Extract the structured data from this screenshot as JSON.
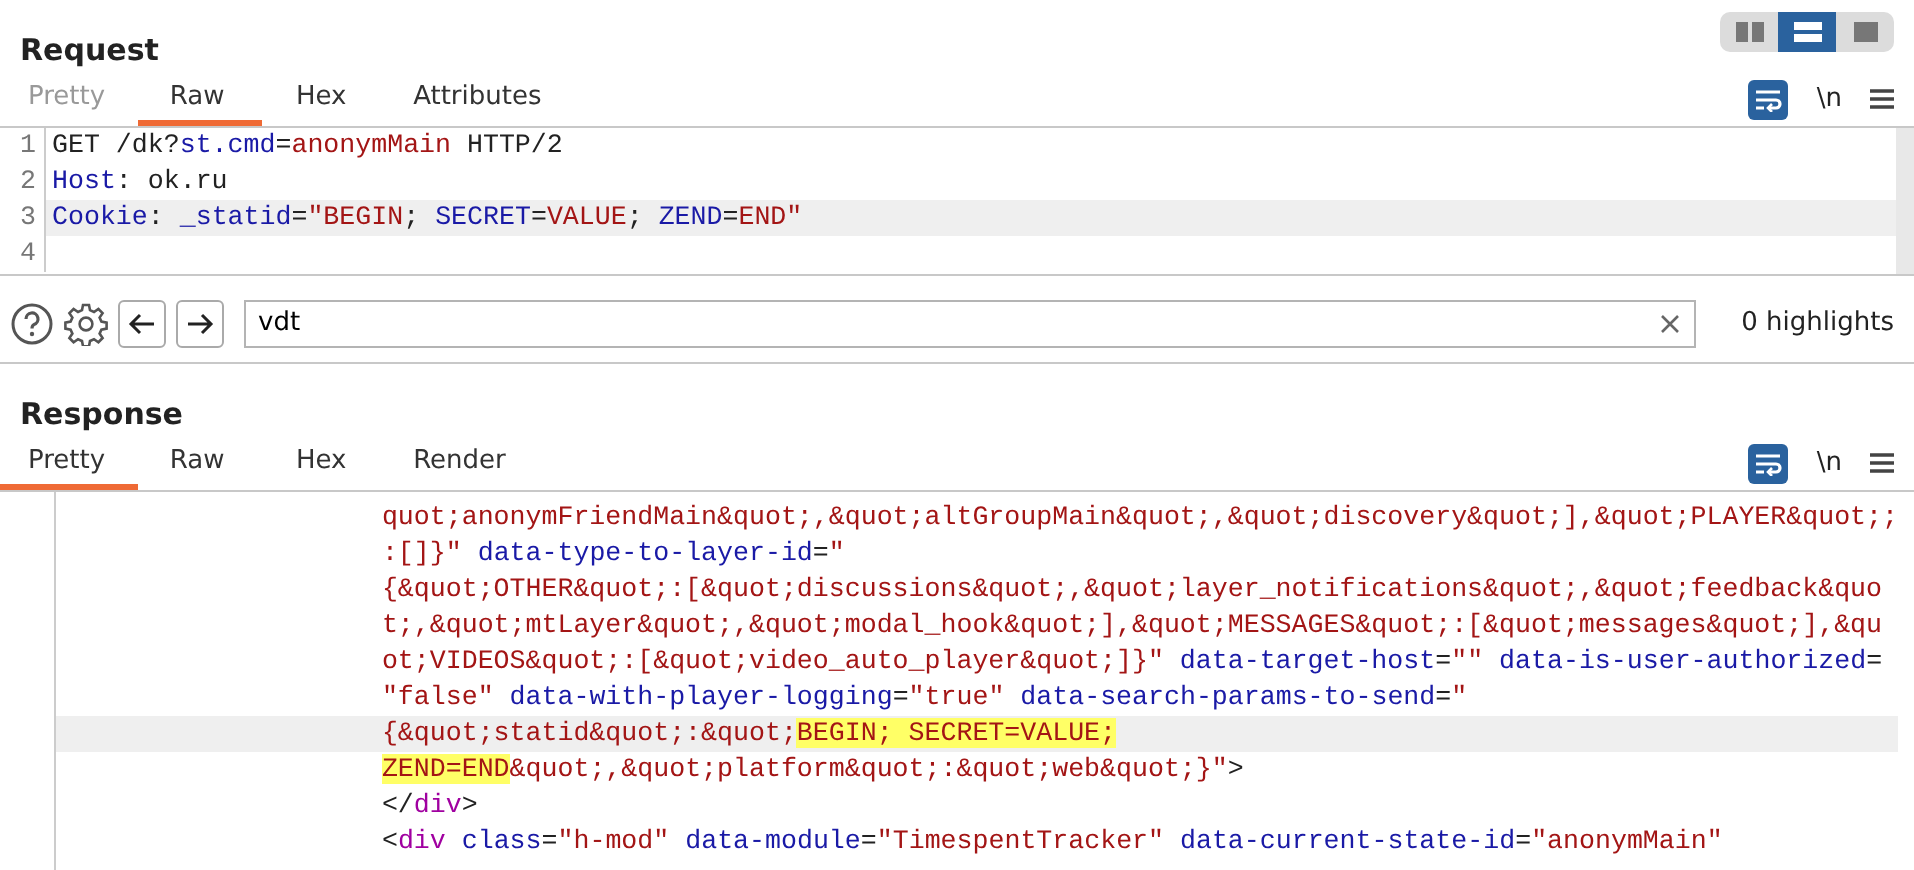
{
  "layout_switcher": [
    {
      "selected": false
    },
    {
      "selected": true
    },
    {
      "selected": false
    }
  ],
  "request": {
    "title": "Request",
    "tabs": [
      {
        "label": "Pretty",
        "selected": false,
        "disabled": true
      },
      {
        "label": "Raw",
        "selected": true,
        "disabled": false
      },
      {
        "label": "Hex",
        "selected": false,
        "disabled": false
      },
      {
        "label": "Attributes",
        "selected": false,
        "disabled": false
      }
    ],
    "toolbar": {
      "wrap_selected": true,
      "newline_label": "\\n"
    },
    "lines": [
      {
        "number": "1",
        "current": false,
        "segments": [
          {
            "text": "GET /dk?",
            "kind": "plain"
          },
          {
            "text": "st.cmd",
            "kind": "name"
          },
          {
            "text": "=",
            "kind": "plain"
          },
          {
            "text": "anonymMain",
            "kind": "value"
          },
          {
            "text": " HTTP/2",
            "kind": "plain"
          }
        ]
      },
      {
        "number": "2",
        "current": false,
        "segments": [
          {
            "text": "Host",
            "kind": "name"
          },
          {
            "text": ": ok.ru",
            "kind": "plain"
          }
        ]
      },
      {
        "number": "3",
        "current": true,
        "segments": [
          {
            "text": "Cookie",
            "kind": "name"
          },
          {
            "text": ": ",
            "kind": "plain"
          },
          {
            "text": "_statid",
            "kind": "name"
          },
          {
            "text": "=",
            "kind": "plain"
          },
          {
            "text": "\"BEGIN",
            "kind": "value"
          },
          {
            "text": "; ",
            "kind": "plain"
          },
          {
            "text": "SECRET",
            "kind": "name"
          },
          {
            "text": "=",
            "kind": "plain"
          },
          {
            "text": "VALUE",
            "kind": "value"
          },
          {
            "text": "; ",
            "kind": "plain"
          },
          {
            "text": "ZEND",
            "kind": "name"
          },
          {
            "text": "=",
            "kind": "plain"
          },
          {
            "text": "END\"",
            "kind": "value"
          }
        ]
      },
      {
        "number": "4",
        "current": false
      }
    ]
  },
  "search": {
    "value": "vdt",
    "result": "0 highlights"
  },
  "response": {
    "title": "Response",
    "tabs": [
      {
        "label": "Pretty",
        "selected": true,
        "disabled": false
      },
      {
        "label": "Raw",
        "selected": false,
        "disabled": false
      },
      {
        "label": "Hex",
        "selected": false,
        "disabled": false
      },
      {
        "label": "Render",
        "selected": false,
        "disabled": false
      }
    ],
    "toolbar": {
      "wrap_selected": true,
      "newline_label": "\\n"
    },
    "lines": [
      {
        "current": false,
        "segments": [
          {
            "text": "quot;anonymFriendMain&quot;,&quot;altGroupMain&quot;,&quot;discovery&quot;],&quot;PLAYER&quot;;",
            "kind": "value"
          }
        ]
      },
      {
        "current": false,
        "segments": [
          {
            "text": ":[]}\"",
            "kind": "value"
          },
          {
            "text": " data-type-to-layer-id",
            "kind": "name"
          },
          {
            "text": "=",
            "kind": "plain"
          },
          {
            "text": "\"",
            "kind": "value"
          }
        ]
      },
      {
        "current": false,
        "segments": [
          {
            "text": "{&quot;OTHER&quot;:[&quot;discussions&quot;,&quot;layer_notifications&quot;,&quot;feedback&quo",
            "kind": "value"
          }
        ]
      },
      {
        "current": false,
        "segments": [
          {
            "text": "t;,&quot;mtLayer&quot;,&quot;modal_hook&quot;],&quot;MESSAGES&quot;:[&quot;messages&quot;],&qu",
            "kind": "value"
          }
        ]
      },
      {
        "current": false,
        "segments": [
          {
            "text": "ot;VIDEOS&quot;:[&quot;video_auto_player&quot;]}\"",
            "kind": "value"
          },
          {
            "text": " data-target-host",
            "kind": "name"
          },
          {
            "text": "=",
            "kind": "plain"
          },
          {
            "text": "\"\"",
            "kind": "value"
          },
          {
            "text": " data-is-user-authorized",
            "kind": "name"
          },
          {
            "text": "=",
            "kind": "plain"
          }
        ]
      },
      {
        "current": false,
        "segments": [
          {
            "text": "\"false\"",
            "kind": "value"
          },
          {
            "text": " data-with-player-logging",
            "kind": "name"
          },
          {
            "text": "=",
            "kind": "plain"
          },
          {
            "text": "\"true\"",
            "kind": "value"
          },
          {
            "text": " data-search-params-to-send",
            "kind": "name"
          },
          {
            "text": "=",
            "kind": "plain"
          },
          {
            "text": "\"",
            "kind": "value"
          }
        ]
      },
      {
        "current": true,
        "segments": [
          {
            "text": "{&quot;statid&quot;:&quot;",
            "kind": "value"
          },
          {
            "text": "BEGIN; SECRET=VALUE;",
            "kind": "match"
          }
        ]
      },
      {
        "current": false,
        "segments": [
          {
            "text": "ZEND=END",
            "kind": "match"
          },
          {
            "text": "&quot;,&quot;platform&quot;:&quot;web&quot;}\"",
            "kind": "value"
          },
          {
            "text": ">",
            "kind": "plain"
          }
        ]
      },
      {
        "current": false,
        "segments": [
          {
            "text": "</",
            "kind": "plain"
          },
          {
            "text": "div",
            "kind": "tag"
          },
          {
            "text": ">",
            "kind": "plain"
          }
        ]
      },
      {
        "current": false,
        "segments": [
          {
            "text": "<",
            "kind": "plain"
          },
          {
            "text": "div",
            "kind": "tag"
          },
          {
            "text": " class",
            "kind": "name"
          },
          {
            "text": "=",
            "kind": "plain"
          },
          {
            "text": "\"h-mod\"",
            "kind": "value"
          },
          {
            "text": " data-module",
            "kind": "name"
          },
          {
            "text": "=",
            "kind": "plain"
          },
          {
            "text": "\"TimespentTracker\"",
            "kind": "value"
          },
          {
            "text": " data-current-state-id",
            "kind": "name"
          },
          {
            "text": "=",
            "kind": "plain"
          },
          {
            "text": "\"anonymMain\"",
            "kind": "value"
          }
        ]
      }
    ]
  }
}
